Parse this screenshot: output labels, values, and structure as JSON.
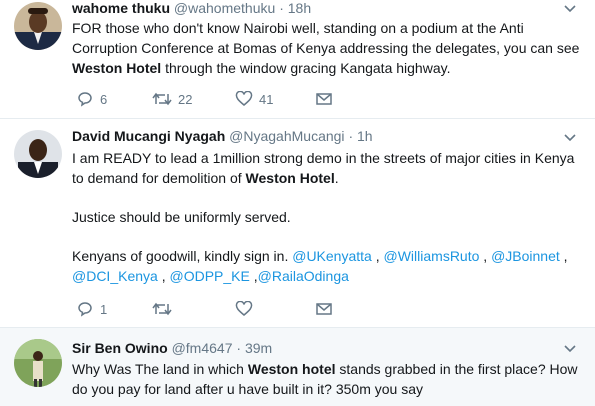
{
  "tweets": [
    {
      "name": "wahome thuku",
      "handle": "@wahomethuku",
      "dot": "·",
      "time": "18h",
      "lines": [
        "FOR those who don't know Nairobi well, standing on a podium at the Anti",
        "Corruption Conference at Bomas of Kenya addressing the delegates, you can see"
      ],
      "line3_bold": "Weston Hotel",
      "line3_rest": " through the window gracing Kangata highway.",
      "replies": "6",
      "retweets": "22",
      "likes": "41"
    },
    {
      "name": "David Mucangi Nyagah",
      "handle": "@NyagahMucangi",
      "dot": "·",
      "time": "1h",
      "line1": "I am READY to lead a 1million strong demo in the streets of major cities in Kenya",
      "line2_pre": "to demand for demolition of ",
      "line2_bold": "Weston Hotel",
      "line2_post": ".",
      "line3": "Justice should be uniformly served.",
      "line4_pre": " Kenyans of goodwill, kindly sign in. ",
      "mentions_a": [
        "@UKenyatta",
        "@WilliamsRuto",
        "@JBoinnet"
      ],
      "mentions_b": [
        "@DCI_Kenya",
        "@ODPP_KE",
        "@RailaOdinga"
      ],
      "sep": " , ",
      "sep2": " ,",
      "trail": " ,",
      "replies": "1",
      "retweets": "",
      "likes": ""
    },
    {
      "name": "Sir Ben Owino",
      "handle": "@fm4647",
      "dot": "·",
      "time": "39m",
      "line1_pre": "Why Was The land in which ",
      "line1_bold": "Weston hotel",
      "line1_post": " stands grabbed in the first place? How",
      "line2": "do you pay for land after u have built in it? 350m you say"
    }
  ],
  "icons": {
    "reply": "reply-icon",
    "retweet": "retweet-icon",
    "like": "heart-icon",
    "dm": "envelope-icon",
    "caret": "chevron-down-icon"
  },
  "colors": {
    "link": "#1b95e0",
    "muted": "#657786",
    "divider": "#e6ecf0",
    "highlight_bg": "#f5f8fa"
  }
}
